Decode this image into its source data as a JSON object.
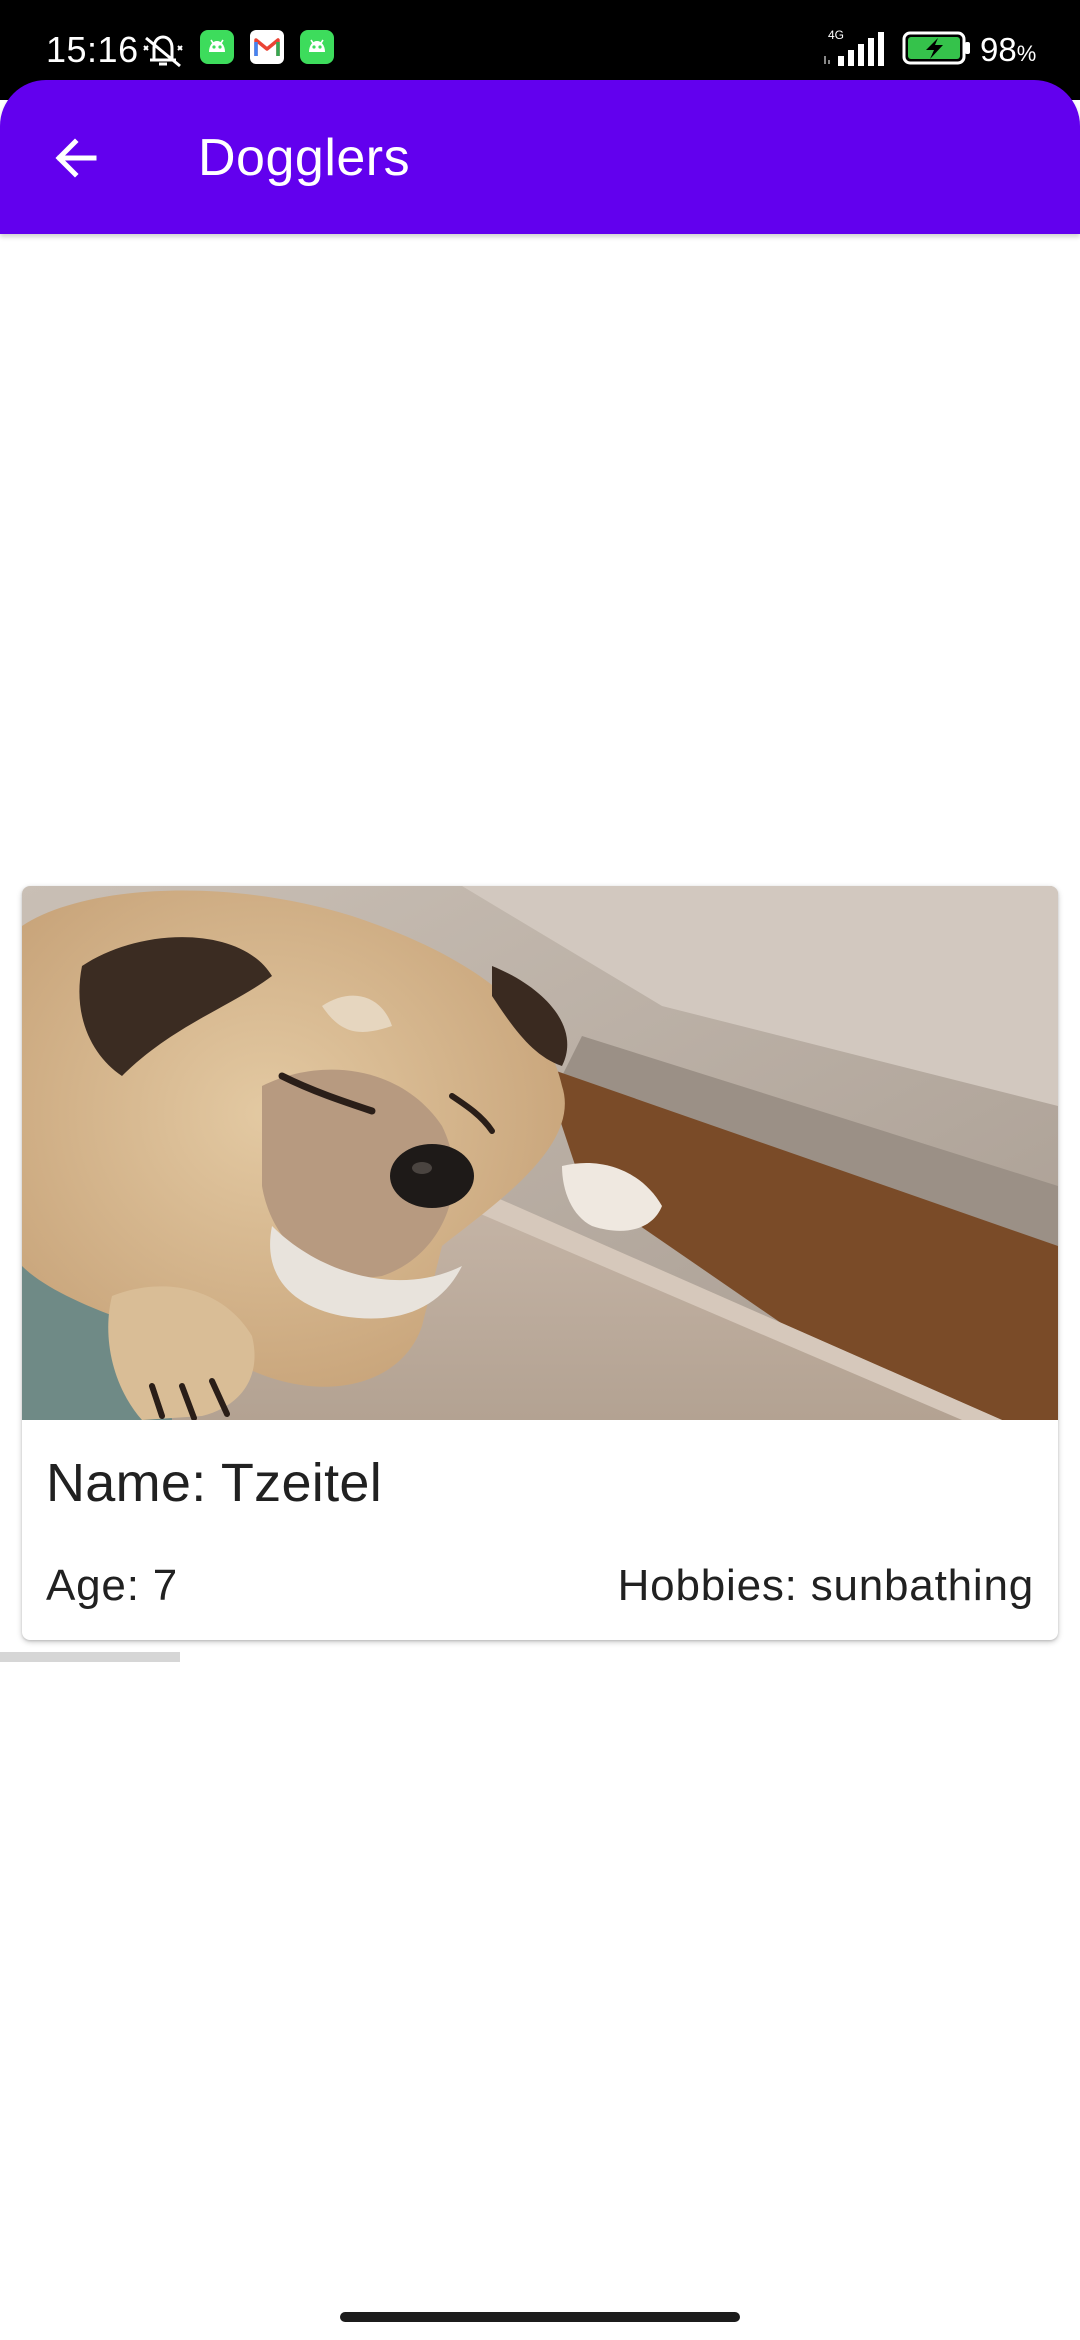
{
  "status_bar": {
    "time": "15:16",
    "network": "4G",
    "battery_percent": "98",
    "battery_unit": "%",
    "icons": [
      "bell-off-icon",
      "android-app-icon",
      "gmail-icon",
      "android-app-icon",
      "signal-icon",
      "battery-charging-icon"
    ]
  },
  "app_bar": {
    "title": "Dogglers",
    "back_icon": "arrow-back-icon",
    "color": "#6200ee"
  },
  "card": {
    "image_alt": "Tzeitel",
    "name_text": "Name: Tzeitel",
    "age_text": "Age: 7",
    "hobbies_text": "Hobbies: sunbathing"
  },
  "colors": {
    "primary": "#6200ee",
    "text": "#212121",
    "status_bar": "#000000"
  }
}
